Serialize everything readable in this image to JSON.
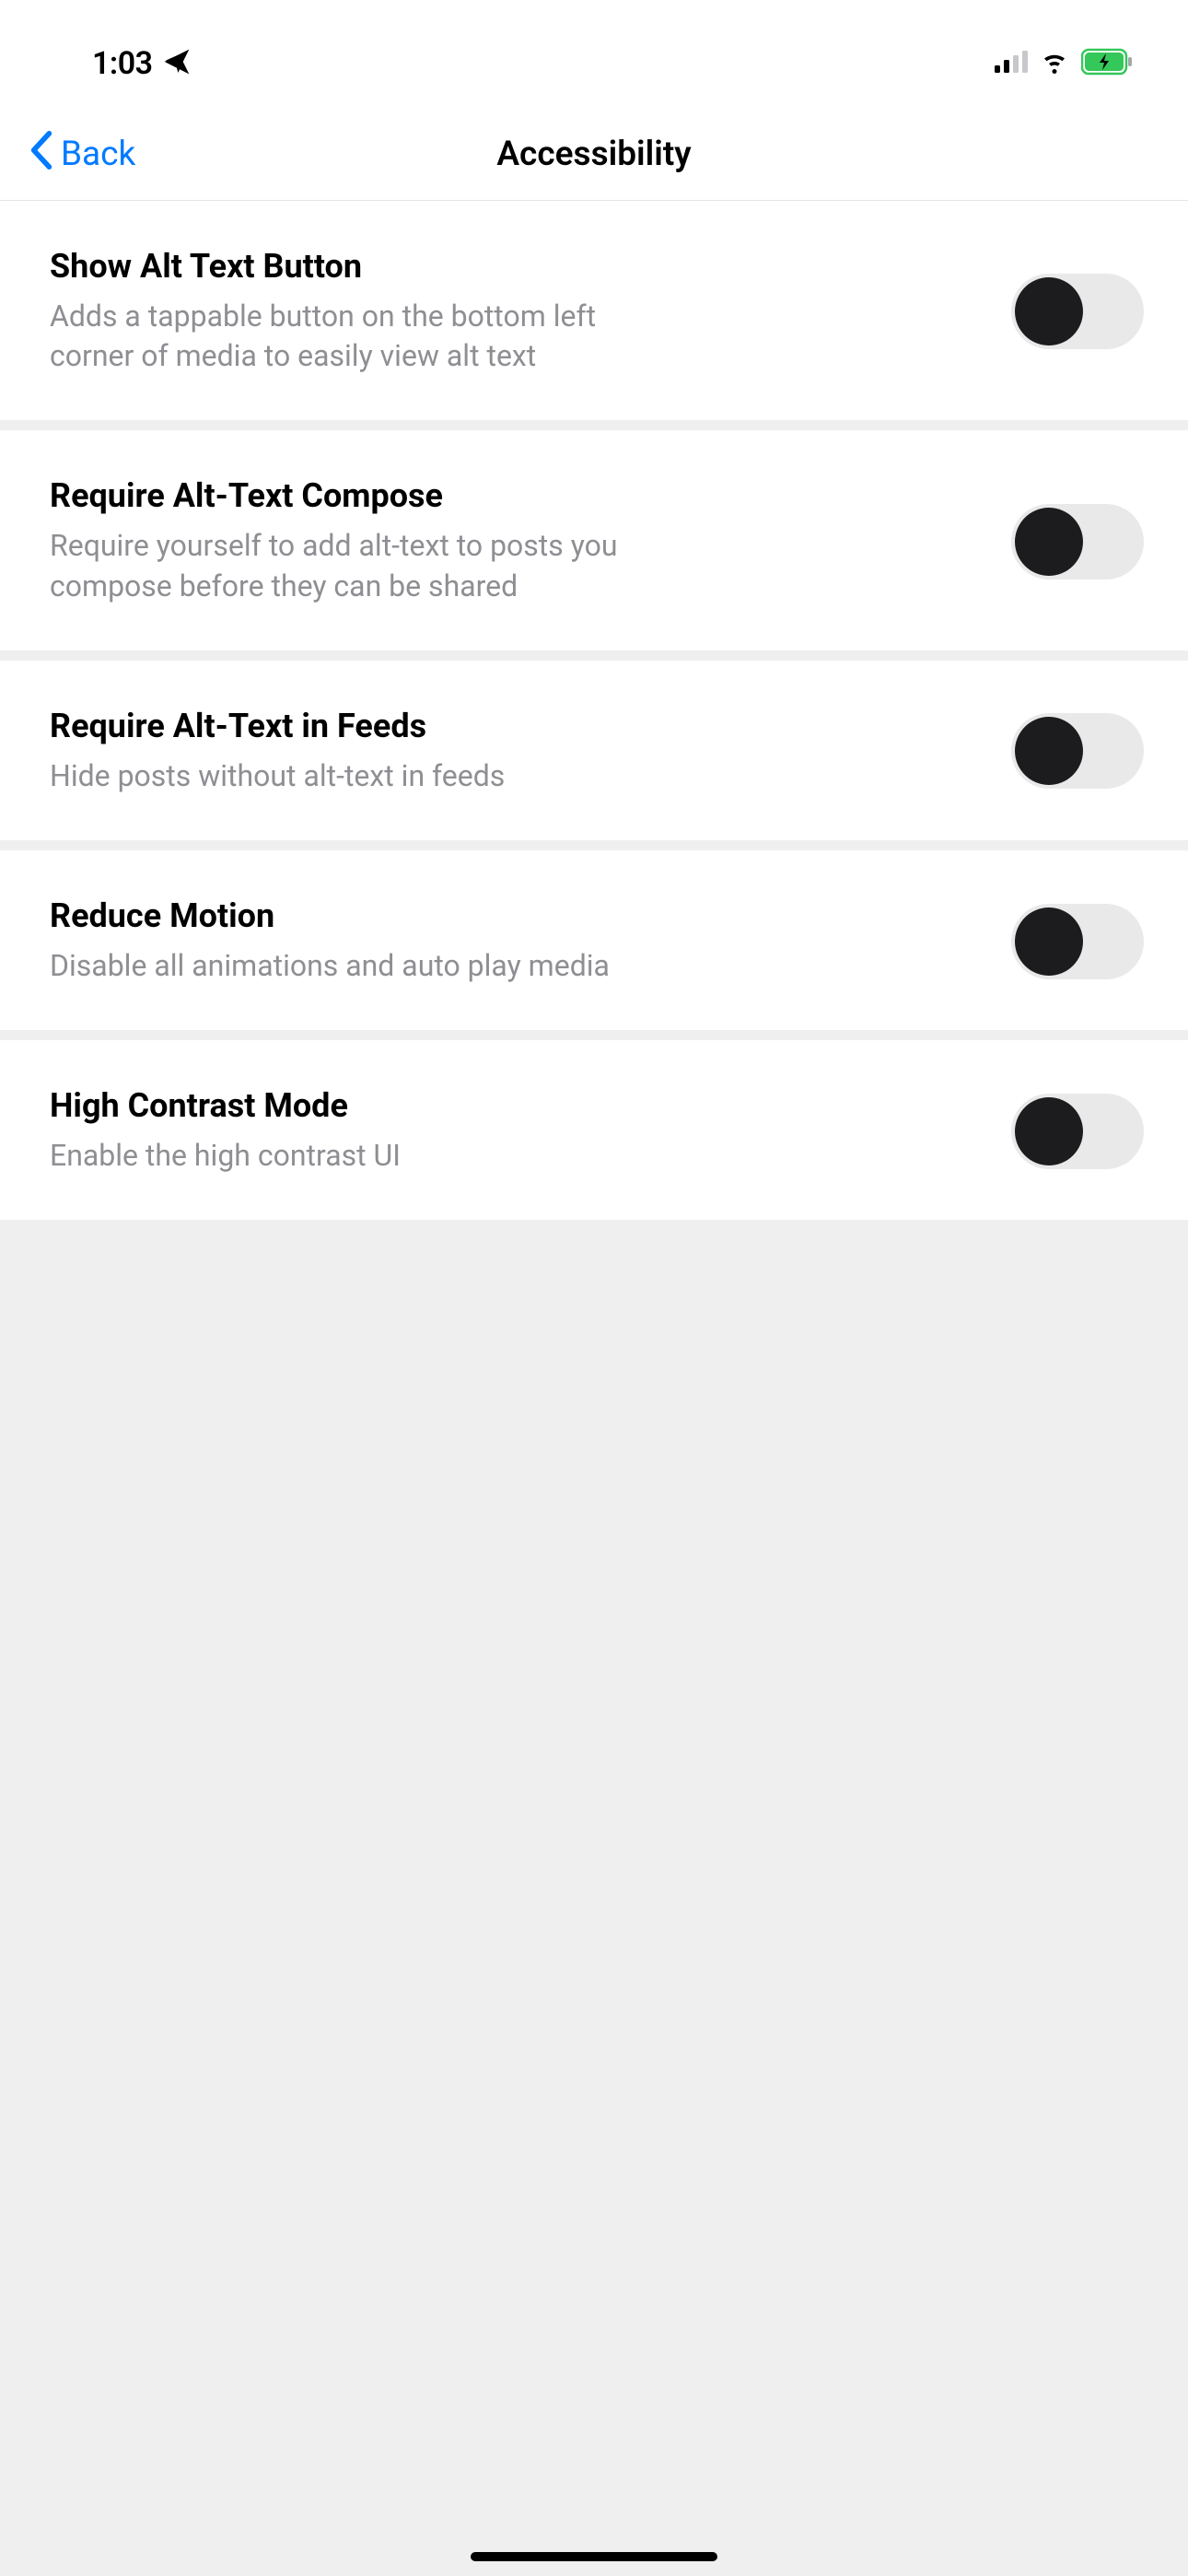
{
  "statusBar": {
    "time": "1:03"
  },
  "nav": {
    "back": "Back",
    "title": "Accessibility"
  },
  "settings": [
    {
      "title": "Show Alt Text Button",
      "desc": "Adds a tappable button on the bottom left corner of media to easily view alt text",
      "on": false
    },
    {
      "title": "Require Alt-Text Compose",
      "desc": "Require yourself to add alt-text to posts you compose before they can be shared",
      "on": false
    },
    {
      "title": "Require Alt-Text in Feeds",
      "desc": "Hide posts without alt-text in feeds",
      "on": false
    },
    {
      "title": "Reduce Motion",
      "desc": "Disable all animations and auto play media",
      "on": false
    },
    {
      "title": "High Contrast Mode",
      "desc": "Enable the high contrast UI",
      "on": false
    }
  ]
}
